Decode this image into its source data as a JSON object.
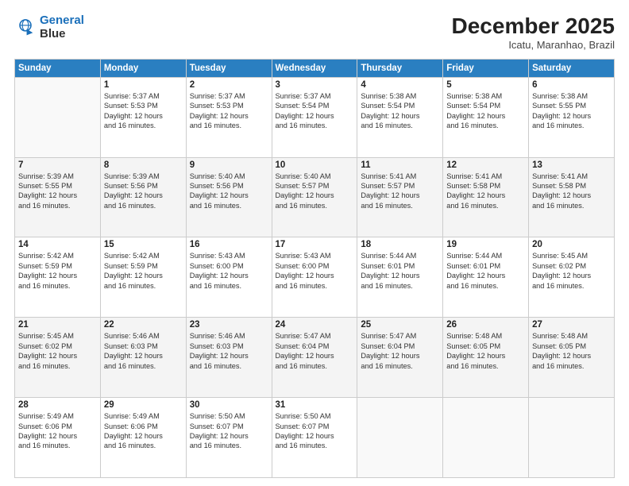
{
  "logo": {
    "line1": "General",
    "line2": "Blue"
  },
  "title": "December 2025",
  "subtitle": "Icatu, Maranhao, Brazil",
  "days_of_week": [
    "Sunday",
    "Monday",
    "Tuesday",
    "Wednesday",
    "Thursday",
    "Friday",
    "Saturday"
  ],
  "weeks": [
    [
      {
        "num": "",
        "info": ""
      },
      {
        "num": "1",
        "info": "Sunrise: 5:37 AM\nSunset: 5:53 PM\nDaylight: 12 hours\nand 16 minutes."
      },
      {
        "num": "2",
        "info": "Sunrise: 5:37 AM\nSunset: 5:53 PM\nDaylight: 12 hours\nand 16 minutes."
      },
      {
        "num": "3",
        "info": "Sunrise: 5:37 AM\nSunset: 5:54 PM\nDaylight: 12 hours\nand 16 minutes."
      },
      {
        "num": "4",
        "info": "Sunrise: 5:38 AM\nSunset: 5:54 PM\nDaylight: 12 hours\nand 16 minutes."
      },
      {
        "num": "5",
        "info": "Sunrise: 5:38 AM\nSunset: 5:54 PM\nDaylight: 12 hours\nand 16 minutes."
      },
      {
        "num": "6",
        "info": "Sunrise: 5:38 AM\nSunset: 5:55 PM\nDaylight: 12 hours\nand 16 minutes."
      }
    ],
    [
      {
        "num": "7",
        "info": "Sunrise: 5:39 AM\nSunset: 5:55 PM\nDaylight: 12 hours\nand 16 minutes."
      },
      {
        "num": "8",
        "info": "Sunrise: 5:39 AM\nSunset: 5:56 PM\nDaylight: 12 hours\nand 16 minutes."
      },
      {
        "num": "9",
        "info": "Sunrise: 5:40 AM\nSunset: 5:56 PM\nDaylight: 12 hours\nand 16 minutes."
      },
      {
        "num": "10",
        "info": "Sunrise: 5:40 AM\nSunset: 5:57 PM\nDaylight: 12 hours\nand 16 minutes."
      },
      {
        "num": "11",
        "info": "Sunrise: 5:41 AM\nSunset: 5:57 PM\nDaylight: 12 hours\nand 16 minutes."
      },
      {
        "num": "12",
        "info": "Sunrise: 5:41 AM\nSunset: 5:58 PM\nDaylight: 12 hours\nand 16 minutes."
      },
      {
        "num": "13",
        "info": "Sunrise: 5:41 AM\nSunset: 5:58 PM\nDaylight: 12 hours\nand 16 minutes."
      }
    ],
    [
      {
        "num": "14",
        "info": "Sunrise: 5:42 AM\nSunset: 5:59 PM\nDaylight: 12 hours\nand 16 minutes."
      },
      {
        "num": "15",
        "info": "Sunrise: 5:42 AM\nSunset: 5:59 PM\nDaylight: 12 hours\nand 16 minutes."
      },
      {
        "num": "16",
        "info": "Sunrise: 5:43 AM\nSunset: 6:00 PM\nDaylight: 12 hours\nand 16 minutes."
      },
      {
        "num": "17",
        "info": "Sunrise: 5:43 AM\nSunset: 6:00 PM\nDaylight: 12 hours\nand 16 minutes."
      },
      {
        "num": "18",
        "info": "Sunrise: 5:44 AM\nSunset: 6:01 PM\nDaylight: 12 hours\nand 16 minutes."
      },
      {
        "num": "19",
        "info": "Sunrise: 5:44 AM\nSunset: 6:01 PM\nDaylight: 12 hours\nand 16 minutes."
      },
      {
        "num": "20",
        "info": "Sunrise: 5:45 AM\nSunset: 6:02 PM\nDaylight: 12 hours\nand 16 minutes."
      }
    ],
    [
      {
        "num": "21",
        "info": "Sunrise: 5:45 AM\nSunset: 6:02 PM\nDaylight: 12 hours\nand 16 minutes."
      },
      {
        "num": "22",
        "info": "Sunrise: 5:46 AM\nSunset: 6:03 PM\nDaylight: 12 hours\nand 16 minutes."
      },
      {
        "num": "23",
        "info": "Sunrise: 5:46 AM\nSunset: 6:03 PM\nDaylight: 12 hours\nand 16 minutes."
      },
      {
        "num": "24",
        "info": "Sunrise: 5:47 AM\nSunset: 6:04 PM\nDaylight: 12 hours\nand 16 minutes."
      },
      {
        "num": "25",
        "info": "Sunrise: 5:47 AM\nSunset: 6:04 PM\nDaylight: 12 hours\nand 16 minutes."
      },
      {
        "num": "26",
        "info": "Sunrise: 5:48 AM\nSunset: 6:05 PM\nDaylight: 12 hours\nand 16 minutes."
      },
      {
        "num": "27",
        "info": "Sunrise: 5:48 AM\nSunset: 6:05 PM\nDaylight: 12 hours\nand 16 minutes."
      }
    ],
    [
      {
        "num": "28",
        "info": "Sunrise: 5:49 AM\nSunset: 6:06 PM\nDaylight: 12 hours\nand 16 minutes."
      },
      {
        "num": "29",
        "info": "Sunrise: 5:49 AM\nSunset: 6:06 PM\nDaylight: 12 hours\nand 16 minutes."
      },
      {
        "num": "30",
        "info": "Sunrise: 5:50 AM\nSunset: 6:07 PM\nDaylight: 12 hours\nand 16 minutes."
      },
      {
        "num": "31",
        "info": "Sunrise: 5:50 AM\nSunset: 6:07 PM\nDaylight: 12 hours\nand 16 minutes."
      },
      {
        "num": "",
        "info": ""
      },
      {
        "num": "",
        "info": ""
      },
      {
        "num": "",
        "info": ""
      }
    ]
  ]
}
